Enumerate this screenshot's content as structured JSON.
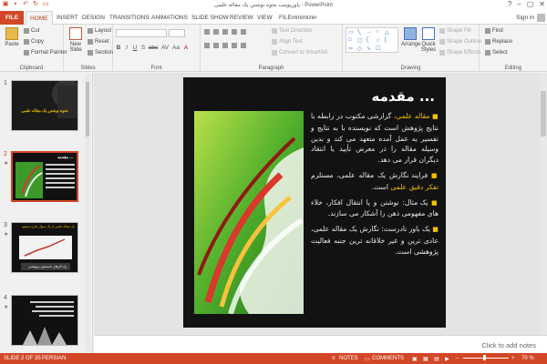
{
  "window": {
    "title": "پاورپوینت نحوه نوشتن یک مقاله علمی - PowerPoint",
    "controls": [
      "?",
      "–",
      "▢",
      "✕"
    ]
  },
  "tabs": {
    "file": "FILE",
    "items": [
      "HOME",
      "INSERT",
      "DESIGN",
      "TRANSITIONS",
      "ANIMATIONS",
      "SLIDE SHOW",
      "REVIEW",
      "VIEW",
      "FILEminimizer"
    ],
    "active": "HOME",
    "signin": "Sign in"
  },
  "ribbon": {
    "clipboard": {
      "name": "Clipboard",
      "paste": "Paste",
      "cut": "Cut",
      "copy": "Copy",
      "format_painter": "Format Painter"
    },
    "slides": {
      "name": "Slides",
      "new_slide_1": "New",
      "new_slide_2": "Slide",
      "layout": "Layout",
      "reset": "Reset",
      "section": "Section"
    },
    "font": {
      "name": "Font",
      "buttons": [
        "B",
        "I",
        "U",
        "S",
        "abc",
        "AV",
        "Aa",
        "A"
      ]
    },
    "paragraph": {
      "name": "Paragraph",
      "text_direction": "Text Direction",
      "align_text": "Align Text",
      "convert_smartart": "Convert to SmartArt"
    },
    "drawing": {
      "name": "Drawing",
      "arrange": "Arrange",
      "quick_styles_1": "Quick",
      "quick_styles_2": "Styles",
      "shape_fill": "Shape Fill",
      "shape_outline": "Shape Outline",
      "shape_effects": "Shape Effects"
    },
    "editing": {
      "name": "Editing",
      "find": "Find",
      "replace": "Replace",
      "select": "Select"
    }
  },
  "thumbnails": [
    {
      "num": "1",
      "title": "نحوه نوشتن یک مقاله علمی"
    },
    {
      "num": "2",
      "title": "مقدمه ..."
    },
    {
      "num": "3",
      "title": "یک مقاله علمی از یک سوال طرح میشود",
      "caption": "راه کارهای نامساوی پژوهشی"
    },
    {
      "num": "4",
      "title": ""
    }
  ],
  "slide": {
    "heading": "مقدمه ...",
    "p1_hl": "مقاله علمی،",
    "p1_rest": "گزارشی مکتوب در رابطه با نتایج پژوهش است که نویسنده با به نتایج و تفسیر به عمل آمده متعهد می کند و بدین وسیله مقاله را در معرض تأیید یا انتقاد دیگران قرار می دهد.",
    "p2_a": "فرایند نگارش یک مقاله علمی، مستلزم",
    "p2_hl": "تفکر دقیق علمی",
    "p2_b": "است.",
    "p3": "یک مثال: نوشتن و یا انتقال افکار، خلاء های مفهومی ذهن را آشکار می سازند.",
    "p4": "یک باور نادرست: نگارش یک مقاله علمی، عادی ترین و غیر خلاقانه ترین جنبه فعالیت پژوهشی است."
  },
  "notes_placeholder": "Click to add notes",
  "status": {
    "slide": "SLIDE 2 OF 35",
    "language": "PERSIAN",
    "notes": "NOTES",
    "comments": "COMMENTS",
    "zoom": "70 %"
  },
  "colors": {
    "accent": "#d24726",
    "highlight": "#f2c200"
  }
}
